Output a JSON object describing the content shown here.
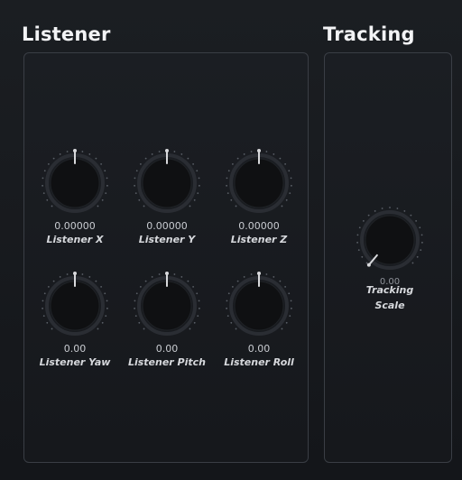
{
  "sections": {
    "listener_title": "Listener",
    "tracking_title": "Tracking"
  },
  "listener": {
    "knobs": [
      {
        "value": "0.00000",
        "label": "Listener X"
      },
      {
        "value": "0.00000",
        "label": "Listener Y"
      },
      {
        "value": "0.00000",
        "label": "Listener Z"
      },
      {
        "value": "0.00",
        "label": "Listener Yaw"
      },
      {
        "value": "0.00",
        "label": "Listener Pitch"
      },
      {
        "value": "0.00",
        "label": "Listener Roll"
      }
    ]
  },
  "tracking": {
    "value": "0.00",
    "label_line1": "Tracking",
    "label_line2": "Scale"
  },
  "colors": {
    "knob_body": "#0f1012",
    "knob_ring": "#2a2d33",
    "indicator": "#d8d9dc",
    "ticks": "#5b6068"
  }
}
